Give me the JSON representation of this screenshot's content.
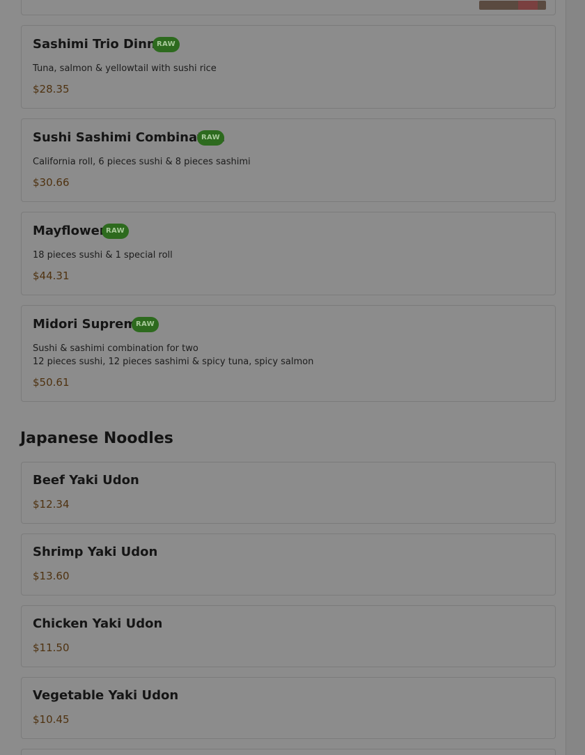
{
  "sushi_items": [
    {
      "name": "Sashimi Trio Dinner",
      "badge": "RAW",
      "description": "Tuna, salmon & yellowtail with sushi rice",
      "price": "$28.35"
    },
    {
      "name": "Sushi Sashimi Combination",
      "badge": "RAW",
      "description": "California roll, 6 pieces sushi & 8 pieces sashimi",
      "price": "$30.66"
    },
    {
      "name": "Mayflower",
      "badge": "RAW",
      "description": "18 pieces sushi & 1 special roll",
      "price": "$44.31"
    },
    {
      "name": "Midori Supreme",
      "badge": "RAW",
      "description_line1": "Sushi & sashimi combination for two",
      "description_line2": "12 pieces sushi, 12 pieces sashimi & spicy tuna, spicy salmon",
      "price": "$50.61"
    }
  ],
  "noodles_section": {
    "title": "Japanese Noodles",
    "items": [
      {
        "name": "Beef Yaki Udon",
        "price": "$12.34"
      },
      {
        "name": "Shrimp Yaki Udon",
        "price": "$13.60"
      },
      {
        "name": "Chicken Yaki Udon",
        "price": "$11.50"
      },
      {
        "name": "Vegetable Yaki Udon",
        "price": "$10.45"
      }
    ]
  },
  "colors": {
    "overlay_dim": "#8c8c8c",
    "badge_bg": "#2d6a1e",
    "badge_text": "#a8c99a",
    "price_text": "#4f3210"
  }
}
